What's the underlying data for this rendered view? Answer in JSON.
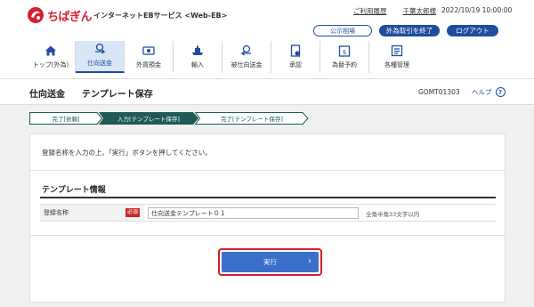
{
  "header": {
    "bank_name": "ちばぎん",
    "service_name": "インターネットEBサービス <Web-EB>",
    "usage_history": "ご利用履歴",
    "user_name": "千葉太郎様",
    "timestamp": "2022/10/19 10:00:00",
    "buttons": {
      "public_rates": "公示相場",
      "end_fx": "外為取引を終了",
      "logout": "ログアウト"
    }
  },
  "nav": {
    "items": [
      {
        "label": "トップ(外為)",
        "icon": "home-icon"
      },
      {
        "label": "仕向送金",
        "icon": "remittance-icon",
        "active": true
      },
      {
        "label": "外貨預金",
        "icon": "deposit-icon"
      },
      {
        "label": "輸入",
        "icon": "import-icon"
      },
      {
        "label": "被仕向送金",
        "icon": "incoming-remittance-icon"
      },
      {
        "label": "承認",
        "icon": "approval-icon"
      },
      {
        "label": "為替予約",
        "icon": "fx-reservation-icon"
      },
      {
        "label": "各種管理",
        "icon": "management-icon"
      }
    ]
  },
  "page": {
    "title": "仕向送金",
    "subtitle": "テンプレート保存",
    "screen_id": "GOMT01303",
    "help_label": "ヘルプ",
    "help_icon": "?"
  },
  "steps": [
    {
      "label": "完了[依頼]",
      "state": "done"
    },
    {
      "label": "入力[テンプレート保存]",
      "state": "current"
    },
    {
      "label": "完了[テンプレート保存]",
      "state": "upcoming"
    }
  ],
  "form": {
    "instruction": "登録名称を入力の上、「実行」ボタンを押してください。",
    "section_title": "テンプレート情報",
    "field_label": "登録名称",
    "required_badge": "必須",
    "field_value": "仕向送金テンプレート０１",
    "field_hint": "全角半角33文字以内",
    "execute_label": "実行",
    "execute_arrow": "›"
  },
  "colors": {
    "brand_red": "#d81e2c",
    "primary_blue": "#1f4d9e",
    "button_blue": "#3b6fc9",
    "step_dark_green": "#1e5a57",
    "highlight_red": "#d21f26"
  }
}
